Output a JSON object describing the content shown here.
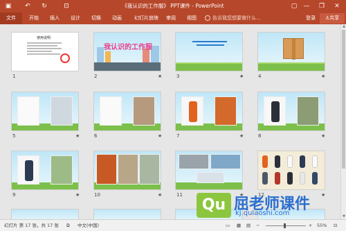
{
  "app": {
    "title": "《我认识的工作服》 PPT课件 - PowerPoint",
    "accent": "#b7472a"
  },
  "quick_access": {
    "save_icon": "save-icon",
    "undo_icon": "undo-icon",
    "redo_icon": "redo-icon",
    "present_icon": "present-icon"
  },
  "window": {
    "restore_label": "▢",
    "minimize_label": "—",
    "maximize_label": "❐",
    "close_label": "✕"
  },
  "ribbon": {
    "file": "文件",
    "tabs": [
      "开始",
      "插入",
      "设计",
      "切换",
      "动画",
      "幻灯片放映",
      "审阅",
      "视图"
    ],
    "tell_me": "告诉我您想要做什么...",
    "login": "登录",
    "share": "共享"
  },
  "slides": [
    {
      "num": "1",
      "title": "使用说明",
      "star": ""
    },
    {
      "num": "2",
      "title": "我认识的工作服",
      "star": "★"
    },
    {
      "num": "3",
      "star": "★"
    },
    {
      "num": "4",
      "star": "★"
    },
    {
      "num": "5",
      "star": "★"
    },
    {
      "num": "6",
      "star": "★"
    },
    {
      "num": "7",
      "star": "★"
    },
    {
      "num": "8",
      "star": "★"
    },
    {
      "num": "9",
      "star": "★"
    },
    {
      "num": "10",
      "star": "★"
    },
    {
      "num": "11",
      "star": "★"
    },
    {
      "num": "12",
      "star": "★"
    }
  ],
  "status": {
    "slide_info": "幻灯片 第 17 张，共 17 张",
    "language": "中文(中国)",
    "zoom": "55%"
  },
  "watermark": {
    "logo": "Qu",
    "name": "屈老师课件",
    "url": "kj.qulaoshi.com"
  }
}
